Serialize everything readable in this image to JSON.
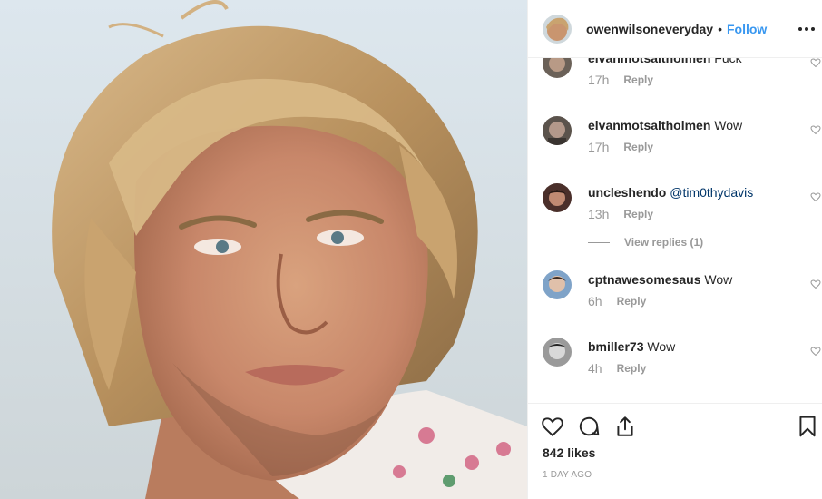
{
  "post": {
    "photo_alt": "owen-wilson-portrait",
    "author": {
      "username": "owenwilsoneveryday",
      "separator": "•",
      "follow_label": "Follow"
    },
    "more_icon": "more-horizontal-icon"
  },
  "comments": [
    {
      "username": "elvanmotsaltholmen",
      "text": "Fuck",
      "time": "17h",
      "reply_label": "Reply"
    },
    {
      "username": "elvanmotsaltholmen",
      "text": "Wow",
      "time": "17h",
      "reply_label": "Reply"
    },
    {
      "username": "uncleshendo",
      "mention": "@tim0thydavis",
      "time": "13h",
      "reply_label": "Reply",
      "view_replies": "View replies (1)"
    },
    {
      "username": "cptnawesomesaus",
      "text": "Wow",
      "time": "6h",
      "reply_label": "Reply"
    },
    {
      "username": "bmiller73",
      "text": "Wow",
      "time": "4h",
      "reply_label": "Reply"
    }
  ],
  "actions": {
    "like_icon": "heart-icon",
    "comment_icon": "comment-icon",
    "share_icon": "share-icon",
    "save_icon": "bookmark-icon",
    "likes": "842 likes",
    "time_ago": "1 DAY AGO"
  },
  "colors": {
    "link": "#3897f0",
    "mention": "#003569",
    "muted": "#999999",
    "text": "#262626",
    "border": "#efefef"
  }
}
